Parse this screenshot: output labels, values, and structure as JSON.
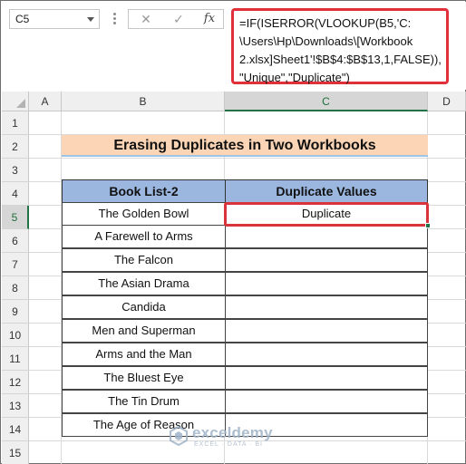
{
  "formula_bar": {
    "name_box": "C5",
    "cancel_symbol": "✕",
    "enter_symbol": "✓",
    "fx_symbol": "fx",
    "formula_lines": [
      "=IF(ISERROR(VLOOKUP(B5,'C:",
      "\\Users\\Hp\\Downloads\\[Workbook",
      "2.xlsx]Sheet1'!$B$4:$B$13,1,FALSE)),",
      "\"Unique\",\"Duplicate\")"
    ]
  },
  "columns": [
    "A",
    "B",
    "C",
    "D"
  ],
  "selected_column": "C",
  "rows": [
    "1",
    "2",
    "3",
    "4",
    "5",
    "6",
    "7",
    "8",
    "9",
    "10",
    "11",
    "12",
    "13",
    "14",
    "15"
  ],
  "selected_row": "5",
  "sheet": {
    "title": "Erasing Duplicates in Two Workbooks",
    "headers": [
      "Book List-2",
      "Duplicate Values"
    ],
    "books": [
      "The Golden Bowl",
      "A Farewell to Arms",
      "The Falcon",
      "The Asian Drama",
      "Candida",
      "Men and Superman",
      "Arms and the Man",
      "The Bluest Eye",
      "The Tin Drum",
      "The Age of Reason"
    ],
    "duplicate_values": [
      "Duplicate",
      "",
      "",
      "",
      "",
      "",
      "",
      "",
      "",
      ""
    ]
  },
  "watermark": {
    "name": "exceldemy",
    "tagline": "EXCEL · DATA · BI"
  },
  "colors": {
    "title_fill": "#fbd5b5",
    "header_fill": "#9bb7e0",
    "highlight": "#e0303a",
    "excel_green": "#217346"
  }
}
